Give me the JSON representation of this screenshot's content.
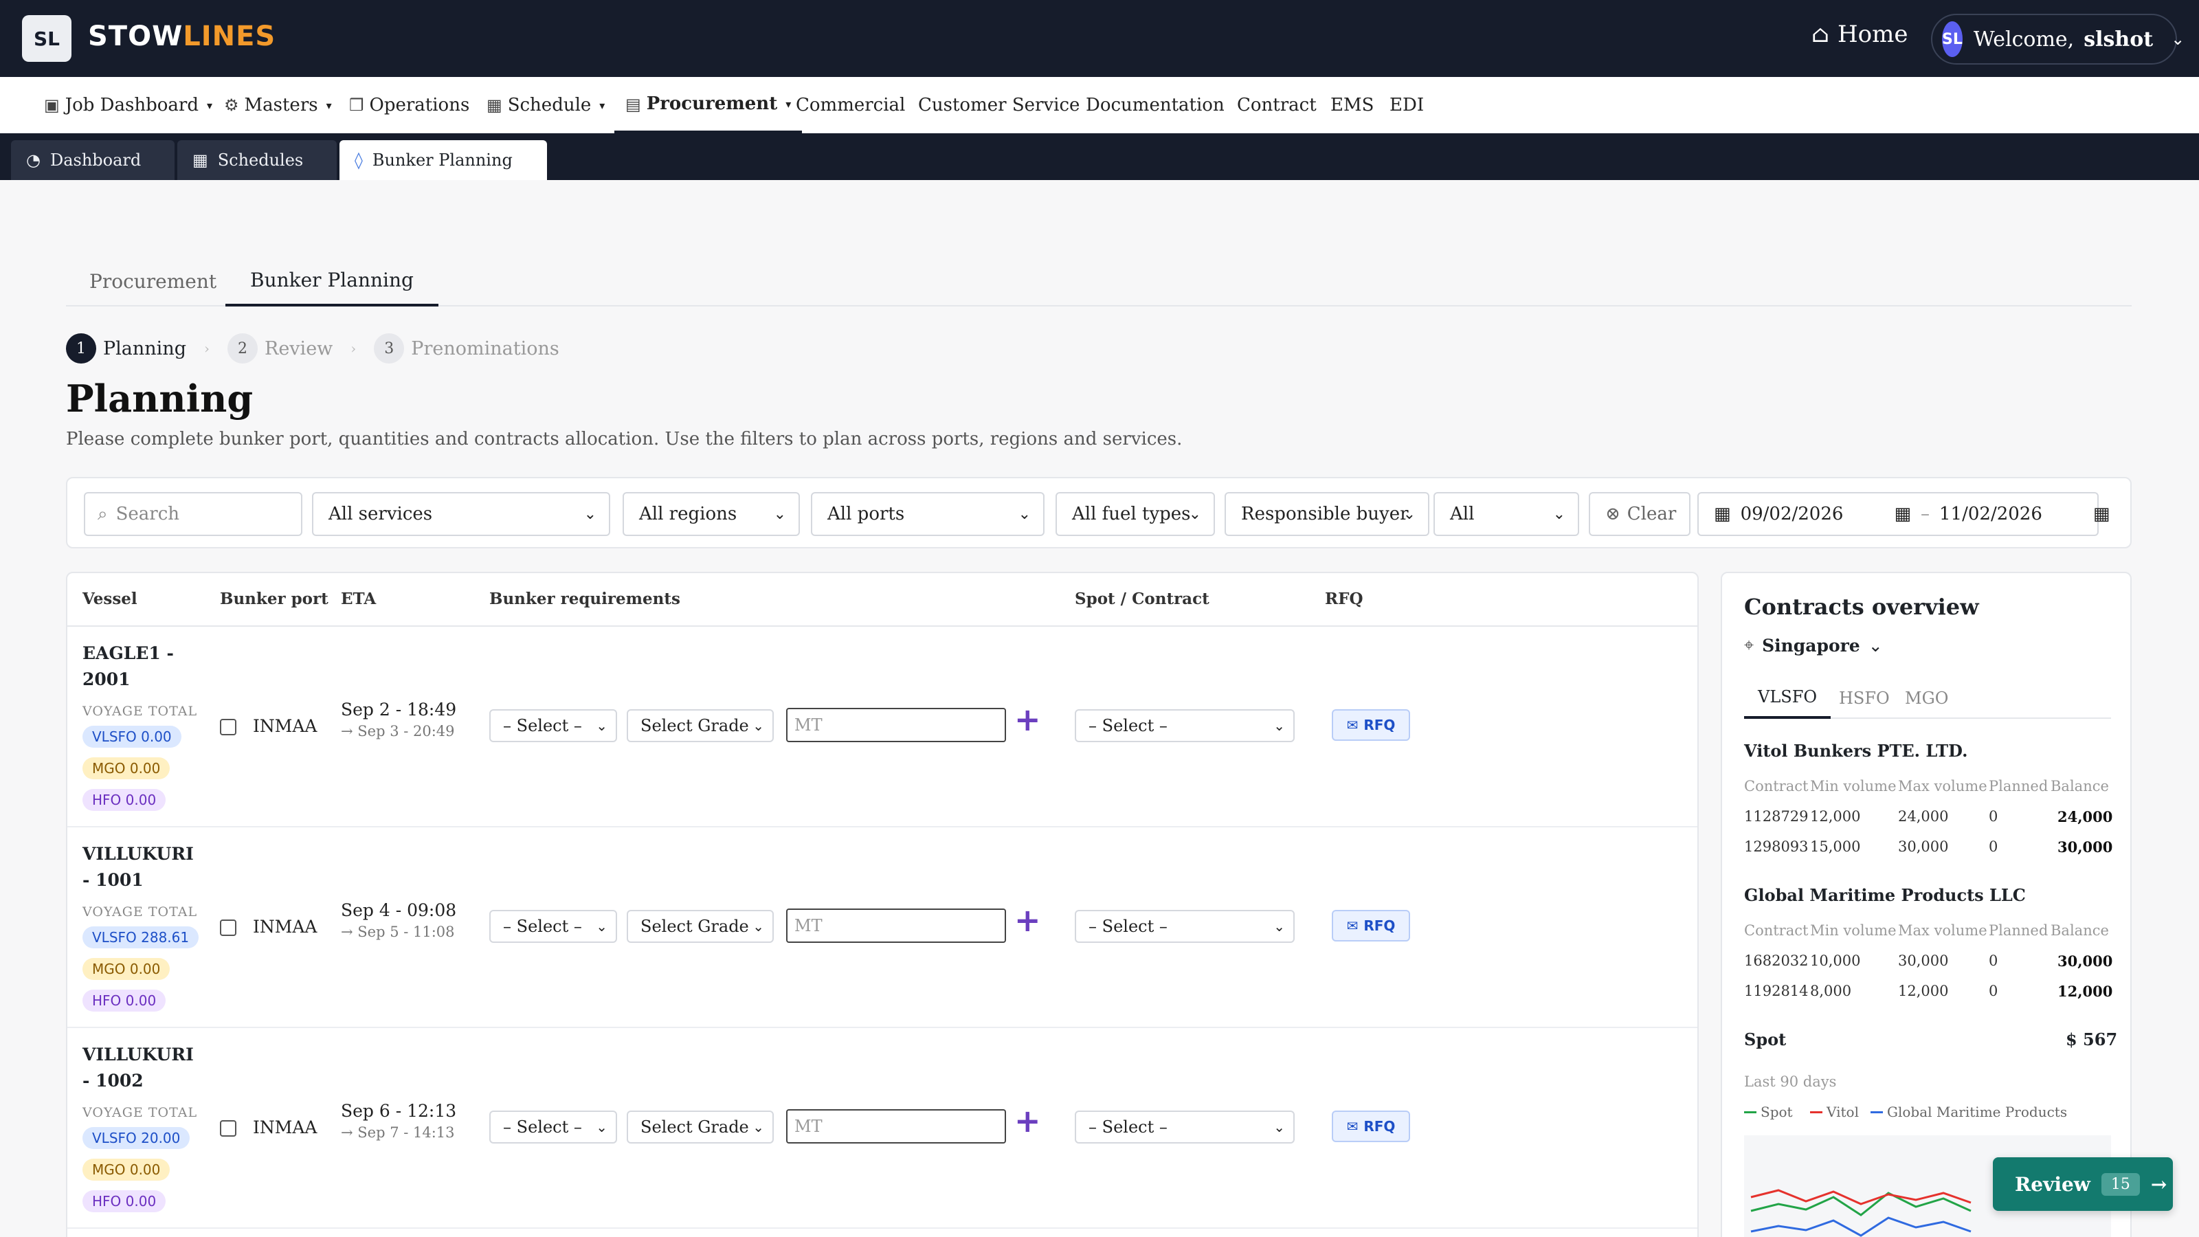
{
  "app": {
    "brand_a": "STOW",
    "brand_b": "LINES",
    "logo": "SL"
  },
  "header": {
    "home_label": "Home",
    "avatar_initials": "SL",
    "welcome": "Welcome,",
    "username": "slshot"
  },
  "nav": {
    "job_dashboard": "Job Dashboard",
    "masters": "Masters",
    "operations": "Operations",
    "schedule": "Schedule",
    "procurement": "Procurement",
    "commercial": "Commercial",
    "customer_service": "Customer Service",
    "documentation": "Documentation",
    "contract": "Contract",
    "ems": "EMS",
    "edi": "EDI"
  },
  "window_tabs": {
    "dashboard": "Dashboard",
    "schedules": "Schedules",
    "bunker_planning": "Bunker Planning"
  },
  "subtabs": {
    "procurement": "Procurement",
    "bunker_planning": "Bunker Planning"
  },
  "stepper": {
    "s1_num": "1",
    "s1_label": "Planning",
    "s2_num": "2",
    "s2_label": "Review",
    "s3_num": "3",
    "s3_label": "Prenominations"
  },
  "page": {
    "title": "Planning",
    "description": "Please complete bunker port, quantities and contracts allocation. Use the filters to plan across ports, regions and services."
  },
  "filters": {
    "search_placeholder": "Search",
    "services": "All services",
    "regions": "All regions",
    "ports": "All ports",
    "fuel_types": "All fuel types",
    "buyer": "Responsible buyer",
    "all": "All",
    "clear": "Clear",
    "date_from": "09/02/2026",
    "date_sep": "–",
    "date_to": "11/02/2026"
  },
  "table": {
    "headers": {
      "vessel": "Vessel",
      "bunker_port": "Bunker port",
      "eta": "ETA",
      "requirements": "Bunker requirements",
      "spot_contract": "Spot / Contract",
      "rfq": "RFQ"
    },
    "voyage_total_label": "VOYAGE TOTAL",
    "select_label": "– Select –",
    "grade_label": "Select Grade",
    "mt_placeholder": "MT",
    "rfq_label": "RFQ",
    "rows": [
      {
        "vessel": "EAGLE1 - 2001",
        "vlsfo": "VLSFO 0.00",
        "mgo": "MGO 0.00",
        "hfo": "HFO 0.00",
        "port": "INMAA",
        "eta": "Sep 2 - 18:49",
        "eta_end": "→ Sep 3 - 20:49"
      },
      {
        "vessel": "VILLUKURI - 1001",
        "vlsfo": "VLSFO 288.61",
        "mgo": "MGO 0.00",
        "hfo": "HFO 0.00",
        "port": "INMAA",
        "eta": "Sep 4 - 09:08",
        "eta_end": "→ Sep 5 - 11:08"
      },
      {
        "vessel": "VILLUKURI - 1002",
        "vlsfo": "VLSFO 20.00",
        "mgo": "MGO 0.00",
        "hfo": "HFO 0.00",
        "port": "INMAA",
        "eta": "Sep 6 - 12:13",
        "eta_end": "→ Sep 7 - 14:13"
      }
    ]
  },
  "contracts": {
    "title": "Contracts overview",
    "location": "Singapore",
    "tabs": [
      "VLSFO",
      "HSFO",
      "MGO"
    ],
    "col_headers": [
      "Contract",
      "Min volume",
      "Max volume",
      "Planned",
      "Balance"
    ],
    "suppliers": [
      {
        "name": "Vitol Bunkers PTE. LTD.",
        "rows": [
          [
            "1128729",
            "12,000",
            "24,000",
            "0",
            "24,000"
          ],
          [
            "1298093",
            "15,000",
            "30,000",
            "0",
            "30,000"
          ]
        ]
      },
      {
        "name": "Global Maritime Products LLC",
        "rows": [
          [
            "1682032",
            "10,000",
            "30,000",
            "0",
            "30,000"
          ],
          [
            "1192814",
            "8,000",
            "12,000",
            "0",
            "12,000"
          ]
        ]
      }
    ],
    "spot_label": "Spot",
    "spot_value": "$ 567",
    "period": "Last 90 days",
    "legend": [
      "Spot",
      "Vitol",
      "Global Maritime Products"
    ],
    "colors": {
      "spot": "#22a447",
      "vitol": "#e5322d",
      "global": "#2f6ae0"
    }
  },
  "review": {
    "label": "Review",
    "count": "15",
    "arrow": "→"
  }
}
